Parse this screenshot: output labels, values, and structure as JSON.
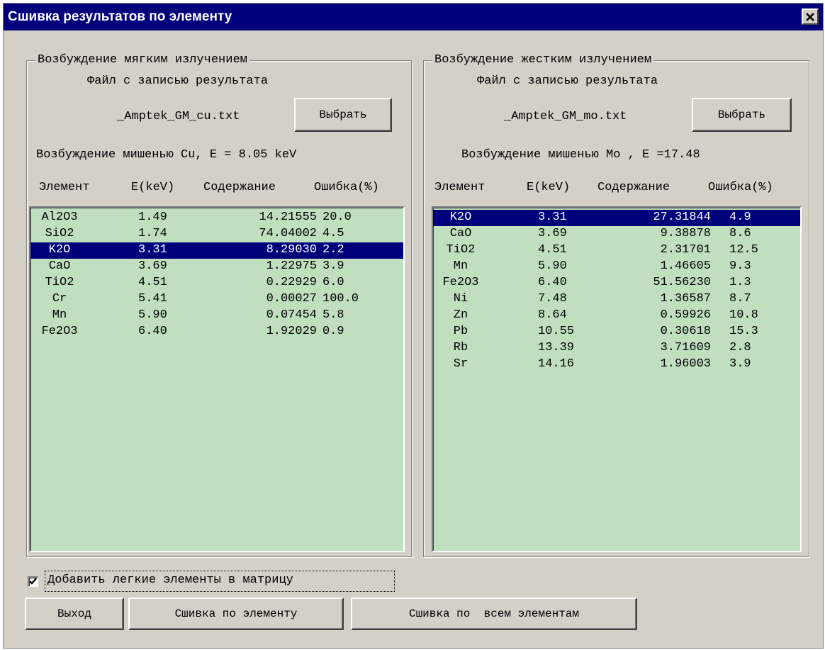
{
  "window": {
    "title": "Сшивка результатов по элементу",
    "close_glyph": "✕"
  },
  "left_panel": {
    "legend": "Возбуждение мягким излучением",
    "file_caption": "Файл с записью результата",
    "file_name": "_Amptek_GM_cu.txt",
    "choose_label": "Выбрать",
    "excitation": "Возбуждение мишенью Cu, E = 8.05 keV",
    "headers": [
      "Элемент",
      "E(keV)",
      "Содержание",
      "Ошибка(%)"
    ],
    "selected_index": 2,
    "rows": [
      [
        "Al2O3",
        "1.49",
        "14.21555",
        "20.0"
      ],
      [
        "SiO2",
        "1.74",
        "74.04002",
        "4.5"
      ],
      [
        "K2O",
        "3.31",
        "8.29030",
        "2.2"
      ],
      [
        "CaO",
        "3.69",
        "1.22975",
        "3.9"
      ],
      [
        "TiO2",
        "4.51",
        "0.22929",
        "6.0"
      ],
      [
        "Cr",
        "5.41",
        "0.00027",
        "100.0"
      ],
      [
        "Mn",
        "5.90",
        "0.07454",
        "5.8"
      ],
      [
        "Fe2O3",
        "6.40",
        "1.92029",
        "0.9"
      ]
    ]
  },
  "right_panel": {
    "legend": "Возбуждение жестким излучением",
    "file_caption": "Файл с записью результата",
    "file_name": "_Amptek_GM_mo.txt",
    "choose_label": "Выбрать",
    "excitation": "Возбуждение мишенью Mo , E =17.48",
    "headers": [
      "Элемент",
      "E(keV)",
      "Содержание",
      "Ошибка(%)"
    ],
    "selected_index": 0,
    "rows": [
      [
        "K2O",
        "3.31",
        "27.31844",
        "4.9"
      ],
      [
        "CaO",
        "3.69",
        "9.38878",
        "8.6"
      ],
      [
        "TiO2",
        "4.51",
        "2.31701",
        "12.5"
      ],
      [
        "Mn",
        "5.90",
        "1.46605",
        "9.3"
      ],
      [
        "Fe2O3",
        "6.40",
        "51.56230",
        "1.3"
      ],
      [
        "Ni",
        "7.48",
        "1.36587",
        "8.7"
      ],
      [
        "Zn",
        "8.64",
        "0.59926",
        "10.8"
      ],
      [
        "Pb",
        "10.55",
        "0.30618",
        "15.3"
      ],
      [
        "Rb",
        "13.39",
        "3.71609",
        "2.8"
      ],
      [
        "Sr",
        "14.16",
        "1.96003",
        "3.9"
      ]
    ]
  },
  "options": {
    "add_light_elements_label": "Добавить легкие элементы в матрицу",
    "add_light_elements_checked": true
  },
  "buttons": {
    "exit_label": "Выход",
    "merge_element_label": "Сшивка по элементу",
    "merge_all_label": "Сшивка по  всем элементам"
  },
  "colors": {
    "title_bar": "#00007b",
    "list_background": "#bfdfbf",
    "selection": "#00007b",
    "dialog_face": "#d4d0c8"
  }
}
